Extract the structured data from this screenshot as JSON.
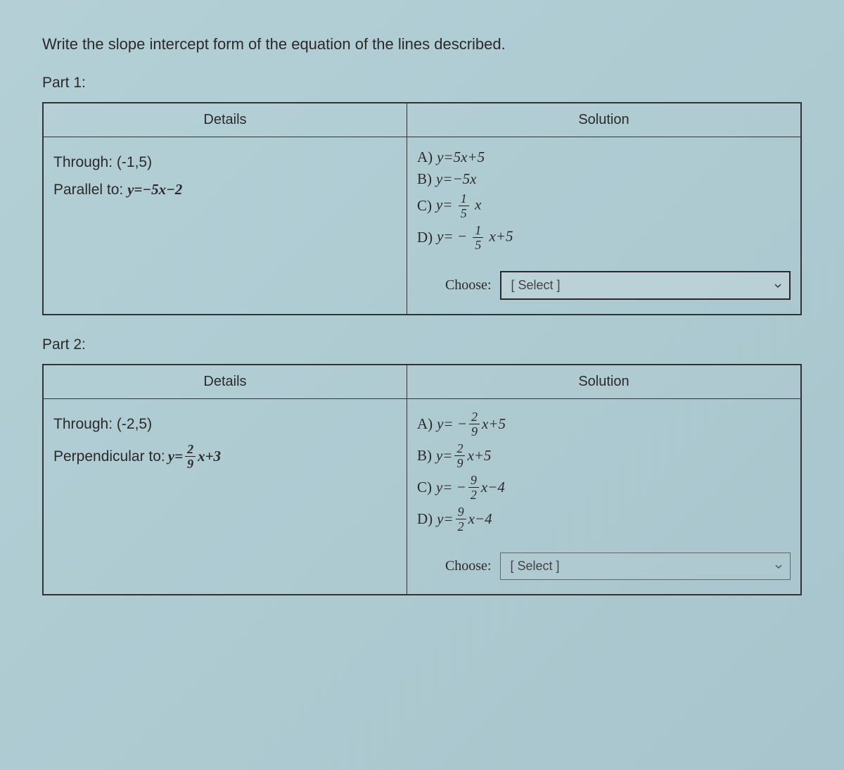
{
  "instruction": "Write the slope intercept form of the equation of the lines described.",
  "parts": [
    {
      "label": "Part 1:",
      "headers": {
        "details": "Details",
        "solution": "Solution"
      },
      "details": {
        "through_label": "Through:",
        "through_point": "(-1,5)",
        "relation_label": "Parallel to:",
        "relation_eq_prefix": "y=",
        "relation_eq_rest": "−5x−2"
      },
      "options": {
        "A": {
          "label": "A)",
          "prefix": "y=",
          "rest": "5x+5"
        },
        "B": {
          "label": "B)",
          "prefix": "y=",
          "rest": "−5x"
        },
        "C": {
          "label": "C)",
          "prefix": "y=",
          "frac_num": "1",
          "frac_den": "5",
          "after": "x"
        },
        "D": {
          "label": "D)",
          "prefix": "y= −",
          "frac_num": "1",
          "frac_den": "5",
          "after": "x+5"
        }
      },
      "choose_label": "Choose:",
      "dropdown_text": "[ Select ]"
    },
    {
      "label": "Part 2:",
      "headers": {
        "details": "Details",
        "solution": "Solution"
      },
      "details": {
        "through_label": "Through:",
        "through_point": "(-2,5)",
        "relation_label": "Perpendicular to:",
        "relation_eq_prefix": "y=",
        "relation_frac_num": "2",
        "relation_frac_den": "9",
        "relation_eq_after": "x+3"
      },
      "options": {
        "A": {
          "label": "A)",
          "prefix": "y= −",
          "frac_num": "2",
          "frac_den": "9",
          "after": "x+5"
        },
        "B": {
          "label": "B)",
          "prefix": "y=",
          "frac_num": "2",
          "frac_den": "9",
          "after": "x+5"
        },
        "C": {
          "label": "C)",
          "prefix": "y= −",
          "frac_num": "9",
          "frac_den": "2",
          "after": "x−4"
        },
        "D": {
          "label": "D)",
          "prefix": "y=",
          "frac_num": "9",
          "frac_den": "2",
          "after": "x−4"
        }
      },
      "choose_label": "Choose:",
      "dropdown_text": "[ Select ]"
    }
  ]
}
